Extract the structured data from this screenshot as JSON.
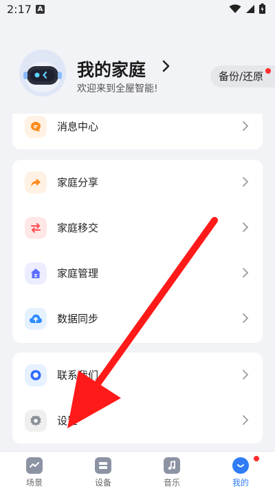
{
  "status_bar": {
    "time": "2:17",
    "notification_letter": "A"
  },
  "profile": {
    "title": "我的家庭",
    "subtitle": "欢迎来到全屋智能!",
    "backup_label": "备份/还原"
  },
  "card1": {
    "items": [
      {
        "label": "消息中心",
        "icon": "message-icon"
      }
    ]
  },
  "card2": {
    "items": [
      {
        "label": "家庭分享",
        "icon": "share-icon"
      },
      {
        "label": "家庭移交",
        "icon": "transfer-icon"
      },
      {
        "label": "家庭管理",
        "icon": "home-manage-icon"
      },
      {
        "label": "数据同步",
        "icon": "cloud-upload-icon"
      }
    ]
  },
  "card3": {
    "items": [
      {
        "label": "联系我们",
        "icon": "contact-icon"
      },
      {
        "label": "设置",
        "icon": "gear-icon"
      }
    ]
  },
  "tabbar": {
    "items": [
      {
        "label": "场景",
        "icon": "scene-icon"
      },
      {
        "label": "设备",
        "icon": "device-icon"
      },
      {
        "label": "音乐",
        "icon": "music-icon"
      },
      {
        "label": "我的",
        "icon": "profile-icon",
        "active": true
      }
    ]
  },
  "colors": {
    "accent": "#2f7cf6",
    "badge": "#ff2d2d",
    "arrow": "#ff1a1a"
  }
}
